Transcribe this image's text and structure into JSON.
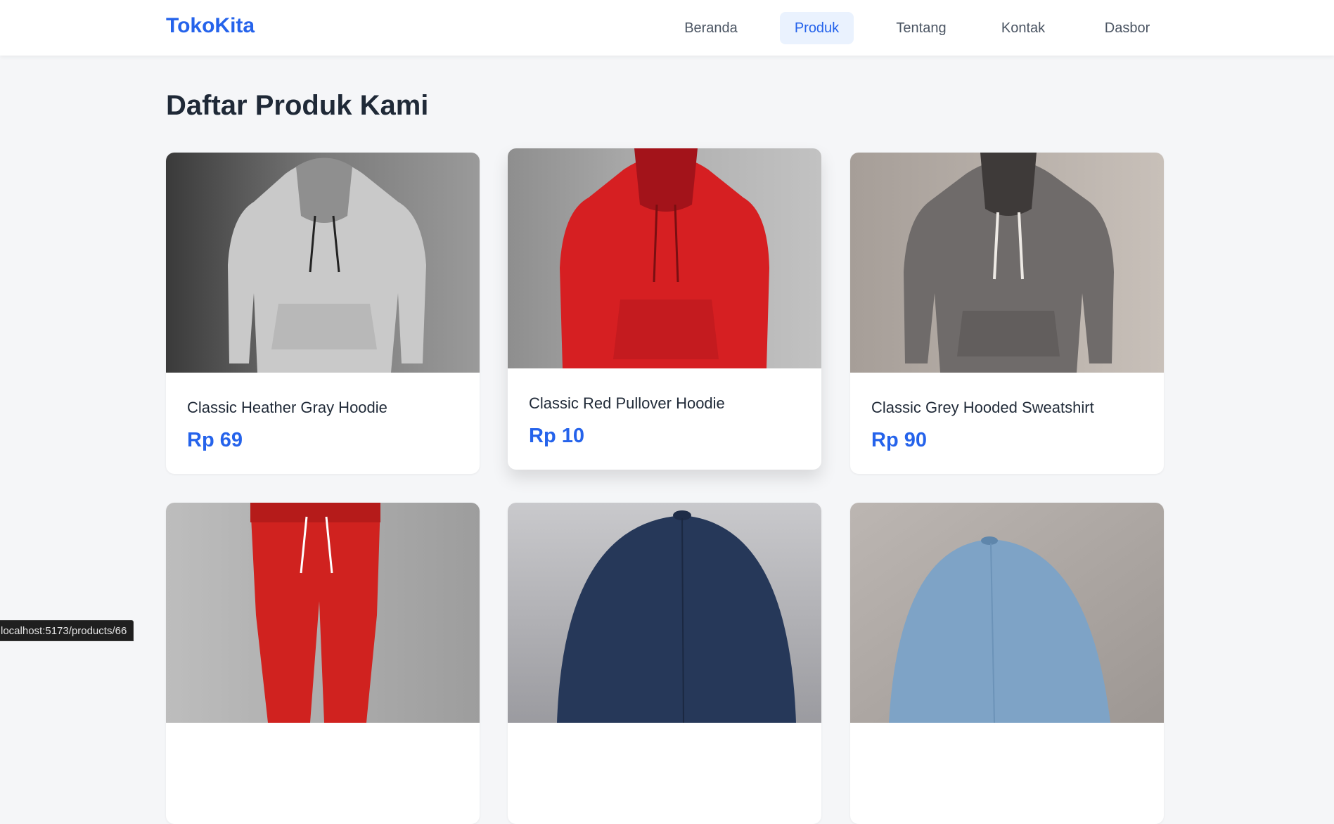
{
  "nav": {
    "brand": "TokoKita",
    "items": [
      {
        "label": "Beranda"
      },
      {
        "label": "Produk",
        "active": true
      },
      {
        "label": "Tentang"
      },
      {
        "label": "Kontak"
      },
      {
        "label": "Dasbor"
      }
    ]
  },
  "page": {
    "title": "Daftar Produk Kami"
  },
  "products": [
    {
      "name": "Classic Heather Gray Hoodie",
      "price": "Rp 69",
      "image": "gray-hoodie-image"
    },
    {
      "name": "Classic Red Pullover Hoodie",
      "price": "Rp 10",
      "image": "red-hoodie-image"
    },
    {
      "name": "Classic Grey Hooded Sweatshirt",
      "price": "Rp 90",
      "image": "grey-sweatshirt-image"
    },
    {
      "name": "",
      "price": "",
      "image": "red-joggers-image"
    },
    {
      "name": "",
      "price": "",
      "image": "navy-cap-image"
    },
    {
      "name": "",
      "price": "",
      "image": "light-blue-cap-image"
    }
  ],
  "status_bar": {
    "url": "localhost:5173/products/66"
  },
  "colors": {
    "accent": "#2563eb",
    "active_bg": "#eaf2fe",
    "background": "#f5f6f8"
  }
}
